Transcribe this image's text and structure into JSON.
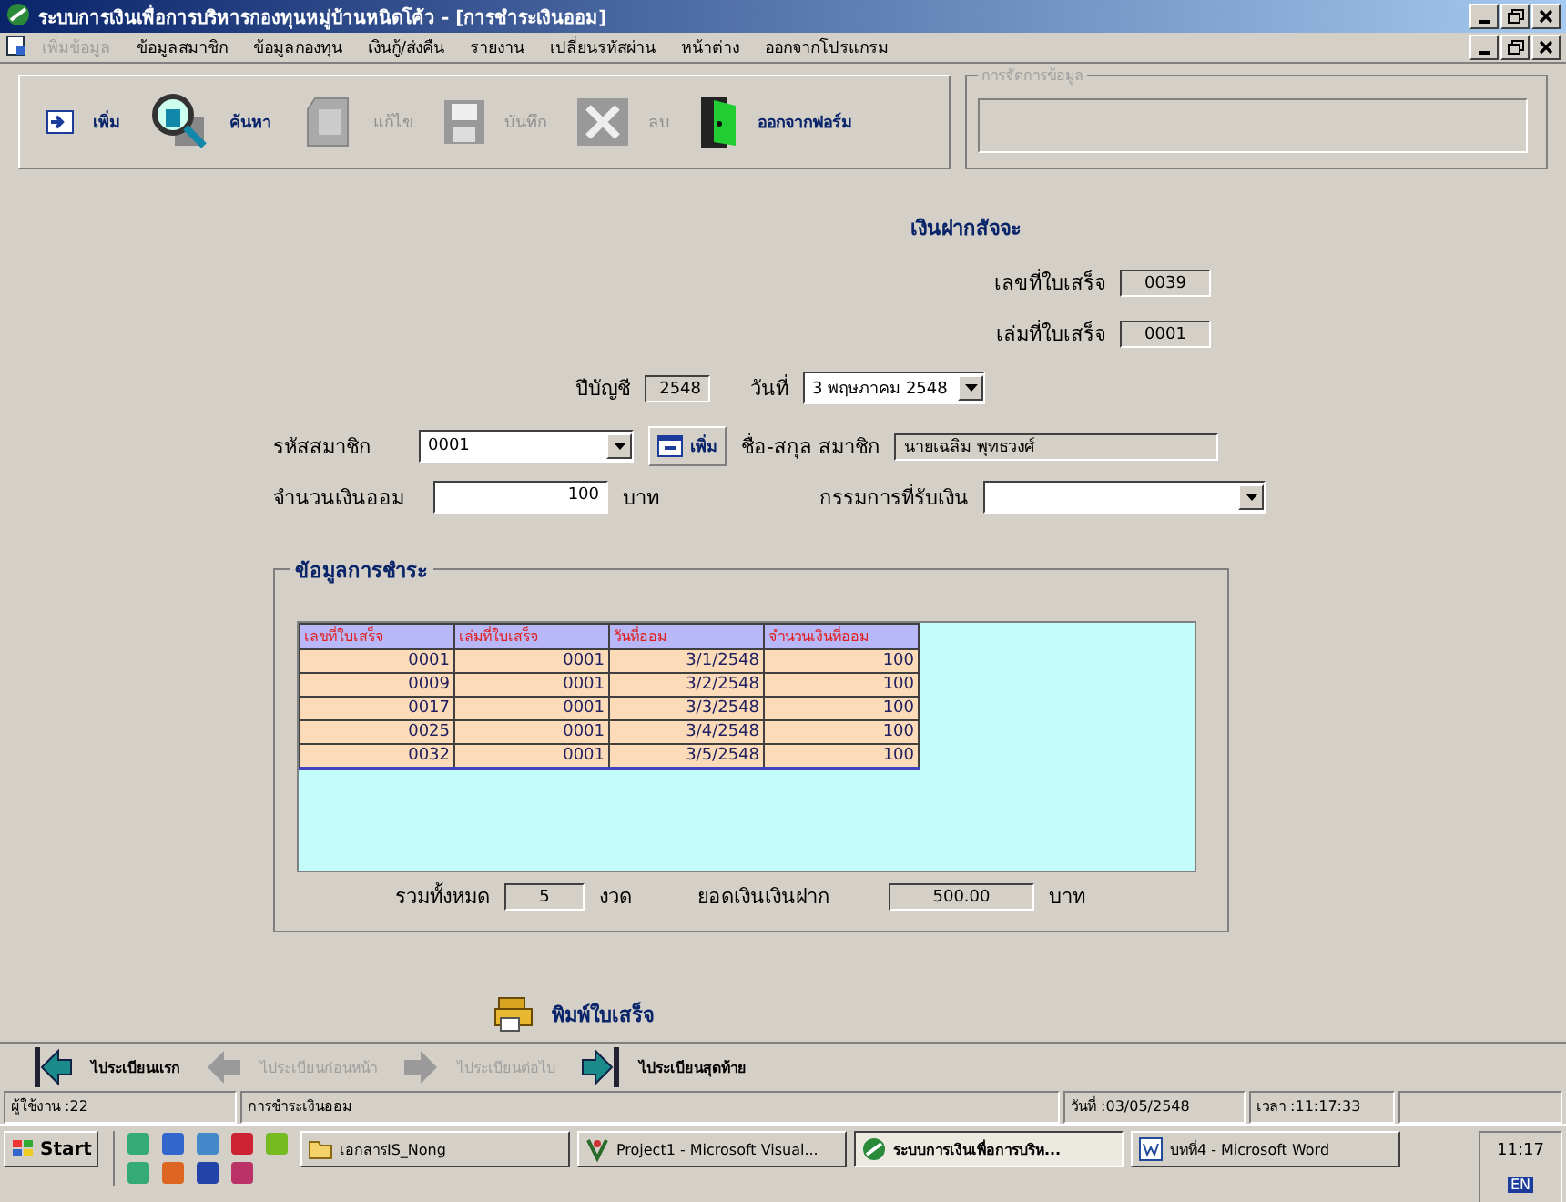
{
  "window": {
    "title": "ระบบการเงินเพื่อการบริหารกองทุนหมู่บ้านหนิดโค้ว - [การชำระเงินออม]"
  },
  "menu": [
    {
      "label": "เพิ่มข้อมูล",
      "disabled": true
    },
    {
      "label": "ข้อมูลสมาชิก",
      "disabled": false
    },
    {
      "label": "ข้อมูลกองทุน",
      "disabled": false
    },
    {
      "label": "เงินกู้/ส่งคืน",
      "disabled": false
    },
    {
      "label": "รายงาน",
      "disabled": false
    },
    {
      "label": "เปลี่ยนรหัสผ่าน",
      "disabled": false
    },
    {
      "label": "หน้าต่าง",
      "disabled": false
    },
    {
      "label": "ออกจากโปรแกรม",
      "disabled": false
    }
  ],
  "toolbar": [
    {
      "kind": "add",
      "label": "เพิ่ม",
      "disabled": false
    },
    {
      "kind": "search",
      "label": "ค้นหา",
      "disabled": false
    },
    {
      "kind": "edit",
      "label": "แก้ไข",
      "disabled": true
    },
    {
      "kind": "save",
      "label": "บันทึก",
      "disabled": true
    },
    {
      "kind": "delete",
      "label": "ลบ",
      "disabled": true
    },
    {
      "kind": "exit",
      "label": "ออกจากฟอร์ม",
      "disabled": false
    }
  ],
  "search_group": {
    "label": "การจัดการข้อมูล"
  },
  "form": {
    "title": "เงินฝากสัจจะ",
    "receipt_no": {
      "label": "เลขที่ใบเสร็จ",
      "value": "0039"
    },
    "book_no": {
      "label": "เล่มที่ใบเสร็จ",
      "value": "0001"
    },
    "fiscal_year": {
      "label": "ปีบัญชี",
      "value": "2548"
    },
    "date": {
      "label": "วันที่",
      "value": "3 พฤษภาคม 2548"
    },
    "member_id": {
      "label": "รหัสสมาชิก",
      "value": "0001"
    },
    "add_member_button": {
      "label": "เพิ่ม"
    },
    "member_name": {
      "label": "ชื่อ-สกุล สมาชิก",
      "value": "นายเฉลิม พุทธวงศ์"
    },
    "amount": {
      "label": "จำนวนเงินออม",
      "value": "100",
      "unit": "บาท"
    },
    "receiver": {
      "label": "กรรมการที่รับเงิน"
    }
  },
  "payment": {
    "title": "ข้อมูลการชำระ",
    "table": {
      "columns": [
        "เลขที่ใบเสร็จ",
        "เล่มที่ใบเสร็จ",
        "วันที่ออม",
        "จำนวนเงินที่ออม"
      ],
      "rows": [
        [
          "0001",
          "0001",
          "3/1/2548",
          "100"
        ],
        [
          "0009",
          "0001",
          "3/2/2548",
          "100"
        ],
        [
          "0017",
          "0001",
          "3/3/2548",
          "100"
        ],
        [
          "0025",
          "0001",
          "3/4/2548",
          "100"
        ],
        [
          "0032",
          "0001",
          "3/5/2548",
          "100"
        ]
      ]
    },
    "total_label": "รวมทั้งหมด",
    "total_value": "5",
    "total_unit": "งวด",
    "balance_label": "ยอดเงินเงินฝาก",
    "balance_value": "500.00",
    "balance_unit": "บาท"
  },
  "print_button": {
    "label": "พิมพ์ใบเสร็จ"
  },
  "nav": [
    {
      "kind": "first",
      "label": "ไประเบียนแรก",
      "disabled": false
    },
    {
      "kind": "prev",
      "label": "ไประเบียนก่อนหน้า",
      "disabled": true
    },
    {
      "kind": "next",
      "label": "ไประเบียนต่อไป",
      "disabled": true
    },
    {
      "kind": "last",
      "label": "ไประเบียนสุดท้าย",
      "disabled": false
    }
  ],
  "status_bar": [
    "ผู้ใช้งาน :22",
    "การชำระเงินออม",
    "วันที่ :03/05/2548",
    "เวลา :11:17:33"
  ],
  "taskbar": {
    "start": "Start",
    "tasks": [
      {
        "kind": "folder",
        "label": "เอกสารIS_Nong",
        "selected": false
      },
      {
        "kind": "vb",
        "label": "Project1 - Microsoft Visual...",
        "selected": false
      },
      {
        "kind": "app",
        "label": "ระบบการเงินเพื่อการบริห...",
        "selected": true
      },
      {
        "kind": "word",
        "label": "บทที่4 - Microsoft Word",
        "selected": false
      }
    ],
    "clock": "11:17",
    "language": "EN"
  }
}
